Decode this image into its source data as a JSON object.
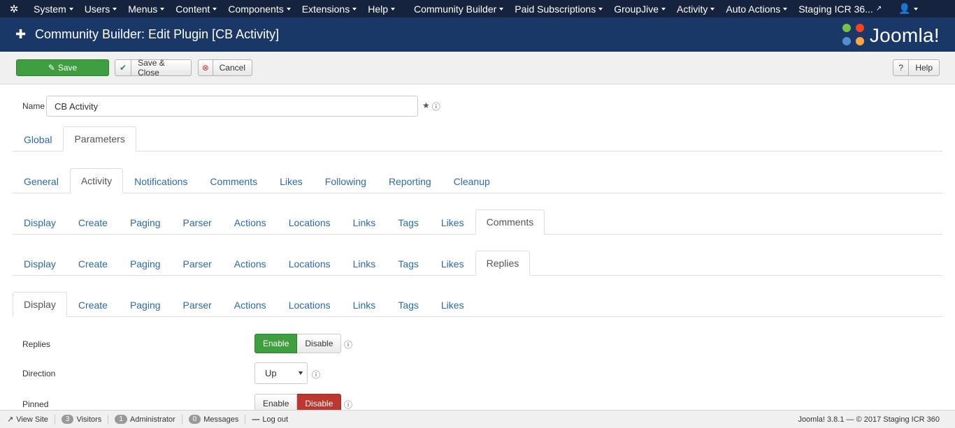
{
  "topnav": {
    "menus": [
      "System",
      "Users",
      "Menus",
      "Content",
      "Components",
      "Extensions",
      "Help"
    ],
    "extra_menus": [
      "Community Builder",
      "Paid Subscriptions",
      "GroupJive",
      "Activity",
      "Auto Actions"
    ],
    "site_link": "Staging ICR 36..."
  },
  "header": {
    "title": "Community Builder: Edit Plugin [CB Activity]",
    "brand": "Joomla!",
    "brand_colors": [
      "#f9a541",
      "#f44321",
      "#5091cd",
      "#7ac143"
    ]
  },
  "toolbar": {
    "save": "Save",
    "save_close": "Save & Close",
    "cancel": "Cancel",
    "help": "Help"
  },
  "name_field": {
    "label": "Name",
    "value": "CB Activity"
  },
  "tabs_level1": [
    "Global",
    "Parameters"
  ],
  "tabs_level2": [
    "General",
    "Activity",
    "Notifications",
    "Comments",
    "Likes",
    "Following",
    "Reporting",
    "Cleanup"
  ],
  "tabs_level3": [
    "Display",
    "Create",
    "Paging",
    "Parser",
    "Actions",
    "Locations",
    "Links",
    "Tags",
    "Likes",
    "Comments"
  ],
  "tabs_level4": [
    "Display",
    "Create",
    "Paging",
    "Parser",
    "Actions",
    "Locations",
    "Links",
    "Tags",
    "Likes",
    "Replies"
  ],
  "tabs_level5": [
    "Display",
    "Create",
    "Paging",
    "Parser",
    "Actions",
    "Locations",
    "Links",
    "Tags",
    "Likes"
  ],
  "form": {
    "replies": {
      "label": "Replies",
      "enable": "Enable",
      "disable": "Disable",
      "selected": "Enable"
    },
    "direction": {
      "label": "Direction",
      "value": "Up"
    },
    "pinned": {
      "label": "Pinned",
      "enable": "Enable",
      "disable": "Disable",
      "selected": "Disable"
    }
  },
  "statusbar": {
    "view_site": "View Site",
    "visitors_count": "3",
    "visitors": "Visitors",
    "admin_count": "1",
    "admin": "Administrator",
    "messages_count": "0",
    "messages": "Messages",
    "logout": "Log out",
    "version": "Joomla! 3.8.1 — © 2017 Staging ICR 360"
  }
}
